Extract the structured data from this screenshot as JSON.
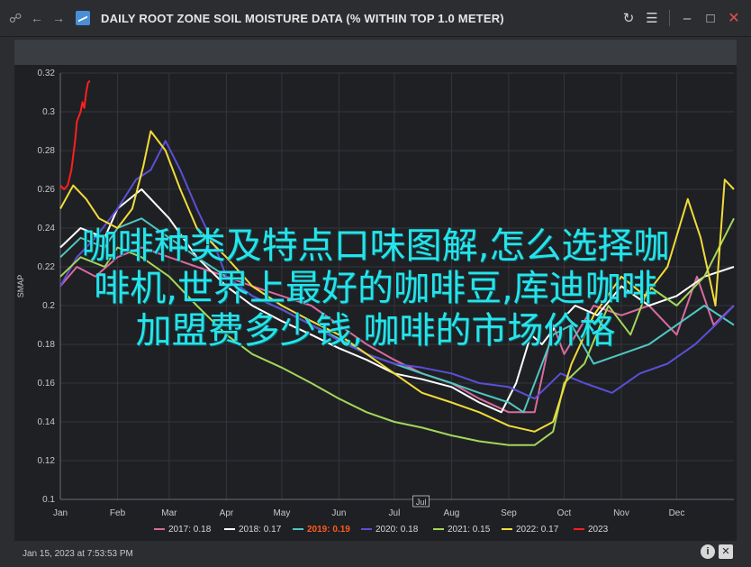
{
  "window": {
    "title": "DAILY ROOT ZONE SOIL MOISTURE DATA (% WITHIN TOP 1.0 METER)",
    "nav_icons": [
      "link-icon",
      "back-arrow-icon",
      "forward-arrow-icon"
    ],
    "controls": [
      "refresh-icon",
      "menu-icon",
      "minimize-icon",
      "maximize-icon",
      "close-icon"
    ]
  },
  "footer": {
    "date": "Jan 15, 2023 at 7:53:53 PM",
    "icons": [
      "info-icon",
      "close-box-icon"
    ]
  },
  "overlay": {
    "lines": [
      "咖啡种类及特点口味图解,怎么选择咖",
      "啡机,世界上最好的咖啡豆,库迪咖啡",
      "加盟费多少钱,咖啡的市场价格"
    ]
  },
  "chart_data": {
    "type": "line",
    "ylabel": "SMAP",
    "ylim": [
      0.1,
      0.32
    ],
    "yticks": [
      0.1,
      0.12,
      0.14,
      0.16,
      0.18,
      0.2,
      0.22,
      0.24,
      0.26,
      0.28,
      0.3,
      0.32
    ],
    "xlim": [
      1,
      366
    ],
    "xticks": [
      {
        "label": "Jan",
        "day": 1
      },
      {
        "label": "Feb",
        "day": 32
      },
      {
        "label": "Mar",
        "day": 60
      },
      {
        "label": "Apr",
        "day": 91
      },
      {
        "label": "May",
        "day": 121
      },
      {
        "label": "Jun",
        "day": 152
      },
      {
        "label": "Jul",
        "day": 182
      },
      {
        "label": "Aug",
        "day": 213
      },
      {
        "label": "Sep",
        "day": 244
      },
      {
        "label": "Oct",
        "day": 274
      },
      {
        "label": "Nov",
        "day": 305
      },
      {
        "label": "Dec",
        "day": 335
      }
    ],
    "x_marker": {
      "label": "Jul",
      "day": 196
    },
    "grid": true,
    "legend_position": "bottom",
    "series": [
      {
        "name": "2017: 0.18",
        "color": "#d96aa0",
        "points": [
          [
            1,
            0.21
          ],
          [
            10,
            0.22
          ],
          [
            20,
            0.215
          ],
          [
            32,
            0.225
          ],
          [
            45,
            0.23
          ],
          [
            60,
            0.225
          ],
          [
            75,
            0.22
          ],
          [
            91,
            0.215
          ],
          [
            105,
            0.21
          ],
          [
            121,
            0.205
          ],
          [
            137,
            0.2
          ],
          [
            152,
            0.19
          ],
          [
            167,
            0.18
          ],
          [
            182,
            0.172
          ],
          [
            197,
            0.165
          ],
          [
            213,
            0.16
          ],
          [
            228,
            0.152
          ],
          [
            244,
            0.145
          ],
          [
            258,
            0.145
          ],
          [
            268,
            0.19
          ],
          [
            274,
            0.175
          ],
          [
            290,
            0.2
          ],
          [
            305,
            0.195
          ],
          [
            320,
            0.2
          ],
          [
            335,
            0.185
          ],
          [
            346,
            0.215
          ],
          [
            355,
            0.19
          ],
          [
            366,
            0.2
          ]
        ]
      },
      {
        "name": "2018: 0.17",
        "color": "#ffffff",
        "points": [
          [
            1,
            0.23
          ],
          [
            12,
            0.24
          ],
          [
            25,
            0.235
          ],
          [
            32,
            0.25
          ],
          [
            45,
            0.26
          ],
          [
            60,
            0.245
          ],
          [
            75,
            0.225
          ],
          [
            91,
            0.21
          ],
          [
            105,
            0.2
          ],
          [
            121,
            0.192
          ],
          [
            137,
            0.185
          ],
          [
            152,
            0.178
          ],
          [
            167,
            0.172
          ],
          [
            182,
            0.165
          ],
          [
            197,
            0.162
          ],
          [
            213,
            0.158
          ],
          [
            228,
            0.15
          ],
          [
            240,
            0.145
          ],
          [
            248,
            0.16
          ],
          [
            256,
            0.185
          ],
          [
            262,
            0.18
          ],
          [
            270,
            0.19
          ],
          [
            280,
            0.2
          ],
          [
            292,
            0.195
          ],
          [
            305,
            0.21
          ],
          [
            320,
            0.2
          ],
          [
            335,
            0.205
          ],
          [
            350,
            0.215
          ],
          [
            366,
            0.22
          ]
        ]
      },
      {
        "name": "2019: 0.19",
        "color": "#4fc7c0",
        "points": [
          [
            1,
            0.225
          ],
          [
            12,
            0.235
          ],
          [
            25,
            0.23
          ],
          [
            32,
            0.24
          ],
          [
            45,
            0.245
          ],
          [
            60,
            0.235
          ],
          [
            75,
            0.225
          ],
          [
            91,
            0.215
          ],
          [
            105,
            0.205
          ],
          [
            121,
            0.198
          ],
          [
            137,
            0.19
          ],
          [
            152,
            0.183
          ],
          [
            167,
            0.175
          ],
          [
            182,
            0.17
          ],
          [
            197,
            0.165
          ],
          [
            213,
            0.16
          ],
          [
            228,
            0.155
          ],
          [
            244,
            0.15
          ],
          [
            252,
            0.145
          ],
          [
            260,
            0.165
          ],
          [
            268,
            0.185
          ],
          [
            278,
            0.19
          ],
          [
            290,
            0.17
          ],
          [
            305,
            0.175
          ],
          [
            320,
            0.18
          ],
          [
            335,
            0.19
          ],
          [
            350,
            0.2
          ],
          [
            366,
            0.19
          ]
        ]
      },
      {
        "name": "2020: 0.18",
        "color": "#5b4fd6",
        "points": [
          [
            1,
            0.21
          ],
          [
            10,
            0.225
          ],
          [
            20,
            0.235
          ],
          [
            32,
            0.25
          ],
          [
            42,
            0.265
          ],
          [
            50,
            0.27
          ],
          [
            58,
            0.285
          ],
          [
            66,
            0.27
          ],
          [
            75,
            0.25
          ],
          [
            85,
            0.23
          ],
          [
            91,
            0.215
          ],
          [
            105,
            0.205
          ],
          [
            121,
            0.198
          ],
          [
            137,
            0.19
          ],
          [
            152,
            0.182
          ],
          [
            167,
            0.175
          ],
          [
            182,
            0.17
          ],
          [
            197,
            0.168
          ],
          [
            213,
            0.165
          ],
          [
            228,
            0.16
          ],
          [
            244,
            0.158
          ],
          [
            258,
            0.152
          ],
          [
            272,
            0.165
          ],
          [
            285,
            0.16
          ],
          [
            300,
            0.155
          ],
          [
            315,
            0.165
          ],
          [
            330,
            0.17
          ],
          [
            345,
            0.18
          ],
          [
            356,
            0.19
          ],
          [
            366,
            0.2
          ]
        ]
      },
      {
        "name": "2021: 0.15",
        "color": "#a4d65a",
        "points": [
          [
            1,
            0.215
          ],
          [
            12,
            0.225
          ],
          [
            25,
            0.22
          ],
          [
            32,
            0.23
          ],
          [
            45,
            0.225
          ],
          [
            60,
            0.215
          ],
          [
            75,
            0.2
          ],
          [
            91,
            0.185
          ],
          [
            105,
            0.175
          ],
          [
            121,
            0.168
          ],
          [
            137,
            0.16
          ],
          [
            152,
            0.152
          ],
          [
            167,
            0.145
          ],
          [
            182,
            0.14
          ],
          [
            197,
            0.137
          ],
          [
            213,
            0.133
          ],
          [
            228,
            0.13
          ],
          [
            244,
            0.128
          ],
          [
            258,
            0.128
          ],
          [
            268,
            0.135
          ],
          [
            274,
            0.16
          ],
          [
            285,
            0.17
          ],
          [
            298,
            0.2
          ],
          [
            310,
            0.185
          ],
          [
            320,
            0.21
          ],
          [
            335,
            0.2
          ],
          [
            350,
            0.215
          ],
          [
            366,
            0.245
          ]
        ]
      },
      {
        "name": "2022: 0.17",
        "color": "#f2dc3a",
        "points": [
          [
            1,
            0.25
          ],
          [
            8,
            0.262
          ],
          [
            15,
            0.255
          ],
          [
            22,
            0.245
          ],
          [
            32,
            0.24
          ],
          [
            40,
            0.25
          ],
          [
            46,
            0.272
          ],
          [
            50,
            0.29
          ],
          [
            58,
            0.28
          ],
          [
            66,
            0.26
          ],
          [
            75,
            0.24
          ],
          [
            91,
            0.225
          ],
          [
            105,
            0.21
          ],
          [
            121,
            0.2
          ],
          [
            137,
            0.192
          ],
          [
            152,
            0.185
          ],
          [
            167,
            0.175
          ],
          [
            182,
            0.165
          ],
          [
            197,
            0.155
          ],
          [
            213,
            0.15
          ],
          [
            228,
            0.145
          ],
          [
            244,
            0.138
          ],
          [
            258,
            0.135
          ],
          [
            268,
            0.14
          ],
          [
            278,
            0.17
          ],
          [
            290,
            0.195
          ],
          [
            305,
            0.215
          ],
          [
            318,
            0.205
          ],
          [
            330,
            0.22
          ],
          [
            341,
            0.255
          ],
          [
            348,
            0.235
          ],
          [
            356,
            0.2
          ],
          [
            361,
            0.265
          ],
          [
            366,
            0.26
          ]
        ]
      },
      {
        "name": "2023",
        "color": "#ff1f1f",
        "points": [
          [
            1,
            0.262
          ],
          [
            3,
            0.26
          ],
          [
            5,
            0.262
          ],
          [
            7,
            0.27
          ],
          [
            9,
            0.285
          ],
          [
            10,
            0.295
          ],
          [
            12,
            0.3
          ],
          [
            13,
            0.305
          ],
          [
            14,
            0.302
          ],
          [
            15,
            0.31
          ],
          [
            16,
            0.315
          ],
          [
            17,
            0.316
          ]
        ]
      }
    ]
  }
}
